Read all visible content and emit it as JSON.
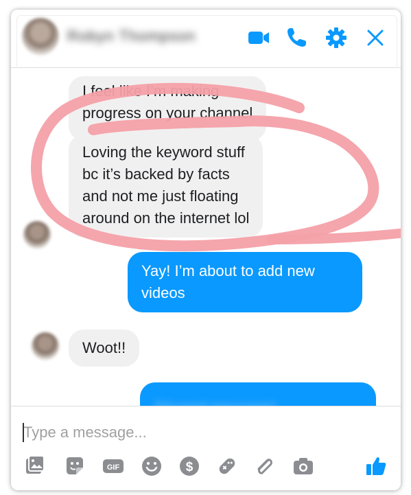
{
  "header": {
    "contact_name": "Robyn Thompson",
    "icons": [
      "video-call-icon",
      "phone-icon",
      "gear-icon",
      "close-icon"
    ]
  },
  "messages": [
    {
      "direction": "incoming",
      "lines": [
        "I feel like I’m making",
        "progress on your channel"
      ]
    },
    {
      "direction": "incoming",
      "lines": [
        "Loving the keyword stuff",
        "bc it’s backed by facts",
        "and not me just floating",
        "around on the internet lol"
      ]
    },
    {
      "direction": "outgoing",
      "lines": [
        "Yay! I’m about to add new",
        "videos"
      ]
    },
    {
      "direction": "incoming",
      "lines": [
        "Woot!!"
      ]
    },
    {
      "direction": "outgoing",
      "lines": [
        "(blurred message)"
      ],
      "blurred": true
    }
  ],
  "composer": {
    "placeholder": "Type a message...",
    "toolbar_icons": [
      "photo-icon",
      "sticker-icon",
      "gif-icon",
      "emoji-icon",
      "payment-icon",
      "game-icon",
      "attachment-icon",
      "camera-icon",
      "thumbs-up-icon"
    ]
  },
  "colors": {
    "accent": "#0a99fe",
    "incoming_bubble": "#f1f0f0",
    "annotation": "#f4a0a8"
  }
}
